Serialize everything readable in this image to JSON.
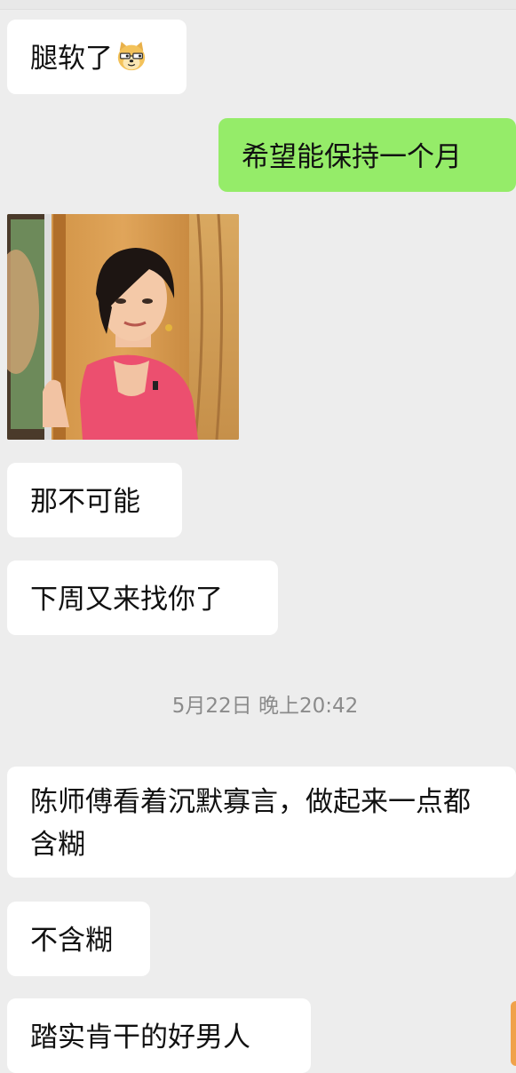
{
  "chat": {
    "messages": [
      {
        "side": "received",
        "text": "腿软了",
        "emoji": "doge-emoji"
      },
      {
        "side": "sent",
        "text": "希望能保持一个月"
      },
      {
        "side": "received",
        "type": "image"
      },
      {
        "side": "received",
        "text": "那不可能"
      },
      {
        "side": "received",
        "text": "下周又来找你了"
      },
      {
        "side": "received",
        "text": "陈师傅看着沉默寡言，做起来一点都含糊"
      },
      {
        "side": "received",
        "text": "不含糊"
      },
      {
        "side": "received",
        "text": "踏实肯干的好男人"
      }
    ],
    "timestamp": "5月22日 晚上20:42"
  },
  "colors": {
    "background": "#ededed",
    "received_bubble": "#ffffff",
    "sent_bubble": "#95ec69",
    "timestamp_text": "#8b8b8b"
  }
}
